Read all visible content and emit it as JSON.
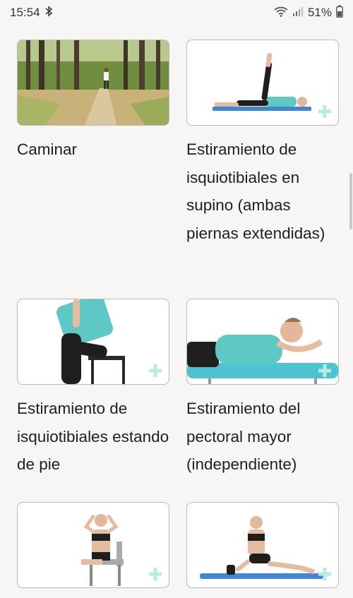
{
  "status_bar": {
    "time": "15:54",
    "battery": "51%",
    "icons": [
      "bluetooth-icon",
      "wifi-icon",
      "signal-icon",
      "battery-icon"
    ]
  },
  "exercises": [
    {
      "title": "Caminar",
      "image": "walking-in-forest"
    },
    {
      "title": "Estiramiento de isquiotibiales en supino (ambas piernas extendidas)",
      "image": "supine-hamstring-stretch"
    },
    {
      "title": "Estiramiento de isquiotibiales estando de pie",
      "image": "standing-hamstring-stretch"
    },
    {
      "title": "Estiramiento del pectoral mayor (independiente)",
      "image": "pectoral-stretch"
    },
    {
      "title": "",
      "image": "seated-woman-hands-behind-head"
    },
    {
      "title": "",
      "image": "woman-on-yoga-mat-with-foam-roller"
    }
  ],
  "colors": {
    "background": "#f7f6f5",
    "card_border": "#b9b9b9",
    "plus_accent": "#b8ece3",
    "mat_blue": "#3f86d6",
    "teal_shirt": "#5ec8c4"
  }
}
